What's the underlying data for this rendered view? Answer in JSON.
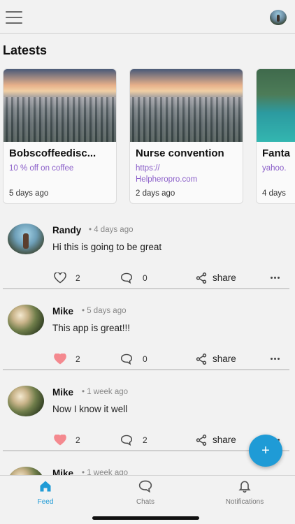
{
  "header": {
    "menu_icon": "hamburger-icon",
    "profile_icon": "user-avatar"
  },
  "latests": {
    "title": "Latests",
    "cards": [
      {
        "title": "Bobscoffeedisc...",
        "link_lines": [
          "10 % off on coffee"
        ],
        "age": "5 days ago",
        "image": "city-skyline"
      },
      {
        "title": "Nurse convention",
        "link_lines": [
          "https://",
          "Helpheropro.com"
        ],
        "age": "2 days ago",
        "image": "city-skyline"
      },
      {
        "title": "Fanta",
        "link_lines": [
          "yahoo."
        ],
        "age": "4 days",
        "image": "lake-mountains"
      }
    ]
  },
  "posts": [
    {
      "name": "Randy",
      "time": "• 4 days ago",
      "message": "Hi this is going to be great",
      "likes": "2",
      "liked": false,
      "comments": "0",
      "share_label": "share"
    },
    {
      "name": "Mike",
      "time": "• 5 days ago",
      "message": "This app is great!!!",
      "likes": "2",
      "liked": true,
      "comments": "0",
      "share_label": "share"
    },
    {
      "name": "Mike",
      "time": "• 1 week ago",
      "message": "Now I know it well",
      "likes": "2",
      "liked": true,
      "comments": "2",
      "share_label": "share"
    },
    {
      "name": "Mike",
      "time": "• 1 week ago"
    }
  ],
  "fab": {
    "label": "+"
  },
  "tabs": [
    {
      "label": "Feed",
      "icon": "home-icon",
      "active": true
    },
    {
      "label": "Chats",
      "icon": "chat-icon",
      "active": false
    },
    {
      "label": "Notifications",
      "icon": "bell-icon",
      "active": false
    }
  ],
  "colors": {
    "accent": "#1f9bd6",
    "link": "#8b5fc9",
    "liked": "#f4898f"
  }
}
